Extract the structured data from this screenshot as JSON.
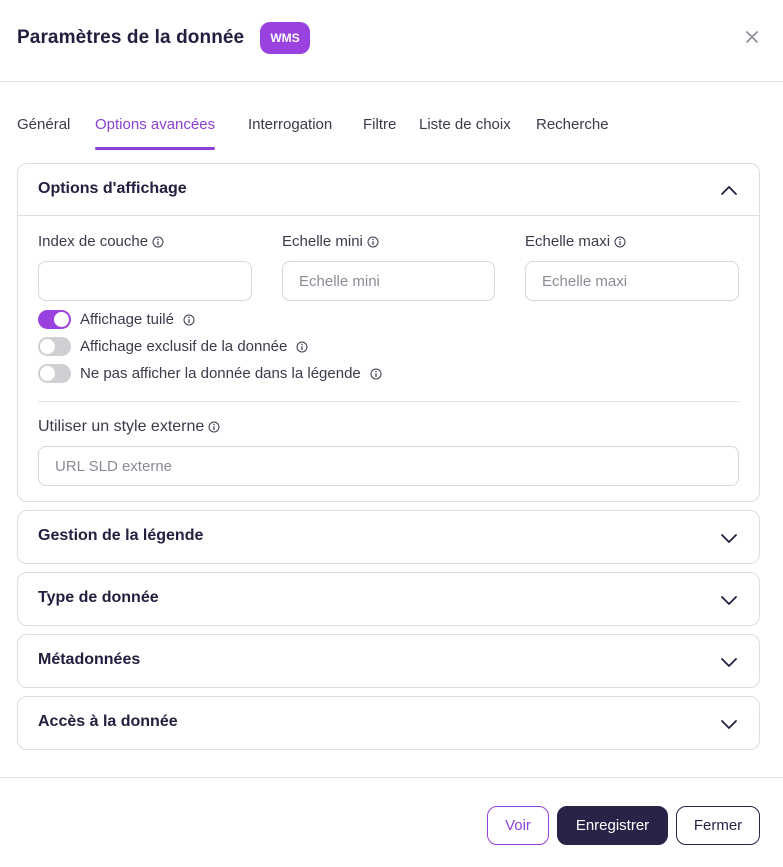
{
  "dialog": {
    "title": "Paramètres de la donnée",
    "badge": "WMS"
  },
  "tabs": [
    {
      "label": "Général"
    },
    {
      "label": "Options avancées"
    },
    {
      "label": "Interrogation"
    },
    {
      "label": "Filtre"
    },
    {
      "label": "Liste de choix"
    },
    {
      "label": "Recherche"
    }
  ],
  "display_options": {
    "title": "Options d'affichage",
    "layer_index": {
      "label": "Index de couche",
      "value": "",
      "placeholder": ""
    },
    "min_scale": {
      "label": "Echelle mini",
      "value": "",
      "placeholder": "Echelle mini"
    },
    "max_scale": {
      "label": "Echelle maxi",
      "value": "",
      "placeholder": "Echelle maxi"
    },
    "toggles": [
      {
        "label": "Affichage tuilé",
        "on": true
      },
      {
        "label": "Affichage exclusif de la donnée",
        "on": false
      },
      {
        "label": "Ne pas afficher la donnée dans la légende",
        "on": false
      }
    ],
    "external_style": {
      "label": "Utiliser un style externe",
      "placeholder": "URL SLD externe"
    }
  },
  "sections": [
    {
      "title": "Gestion de la légende"
    },
    {
      "title": "Type de donnée"
    },
    {
      "title": "Métadonnées"
    },
    {
      "title": "Accès à la donnée"
    }
  ],
  "footer": {
    "view_label": "Voir",
    "save_label": "Enregistrer",
    "close_label": "Fermer"
  },
  "colors": {
    "accent": "#9a42e0",
    "primary_dark": "#272448"
  }
}
